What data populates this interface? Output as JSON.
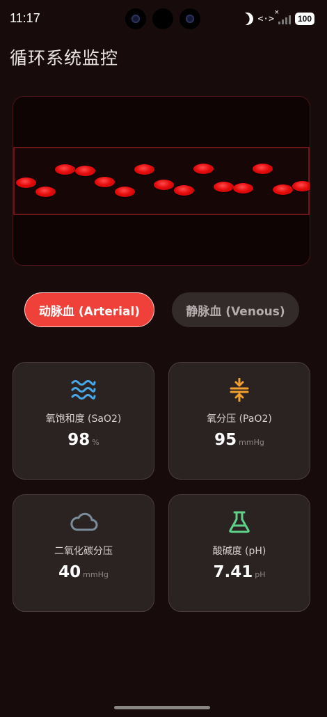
{
  "status_bar": {
    "time": "11:17",
    "battery": "100",
    "icons": [
      "moon-icon",
      "code-icon",
      "signal-icon",
      "battery-icon"
    ]
  },
  "page": {
    "title": "循环系统监控"
  },
  "blood_toggle": {
    "arterial_label": "动脉血 (Arterial)",
    "venous_label": "静脉血 (Venous)",
    "selected": "arterial"
  },
  "metrics": [
    {
      "icon": "waves-icon",
      "label": "氧饱和度 (SaO2)",
      "value": "98",
      "unit": "%",
      "color": "#4aa8e8"
    },
    {
      "icon": "compress-icon",
      "label": "氧分压 (PaO2)",
      "value": "95",
      "unit": "mmHg",
      "color": "#f0a030"
    },
    {
      "icon": "cloud-icon",
      "label": "二氧化碳分压",
      "value": "40",
      "unit": "mmHg",
      "color": "#7b8d9a"
    },
    {
      "icon": "flask-icon",
      "label": "酸碱度 (pH)",
      "value": "7.41",
      "unit": "pH",
      "color": "#5fd28a"
    }
  ],
  "colors": {
    "background": "#180b0b",
    "accent": "#f0403a",
    "blood_cell": "#e50d0d",
    "card": "#2b2222"
  }
}
